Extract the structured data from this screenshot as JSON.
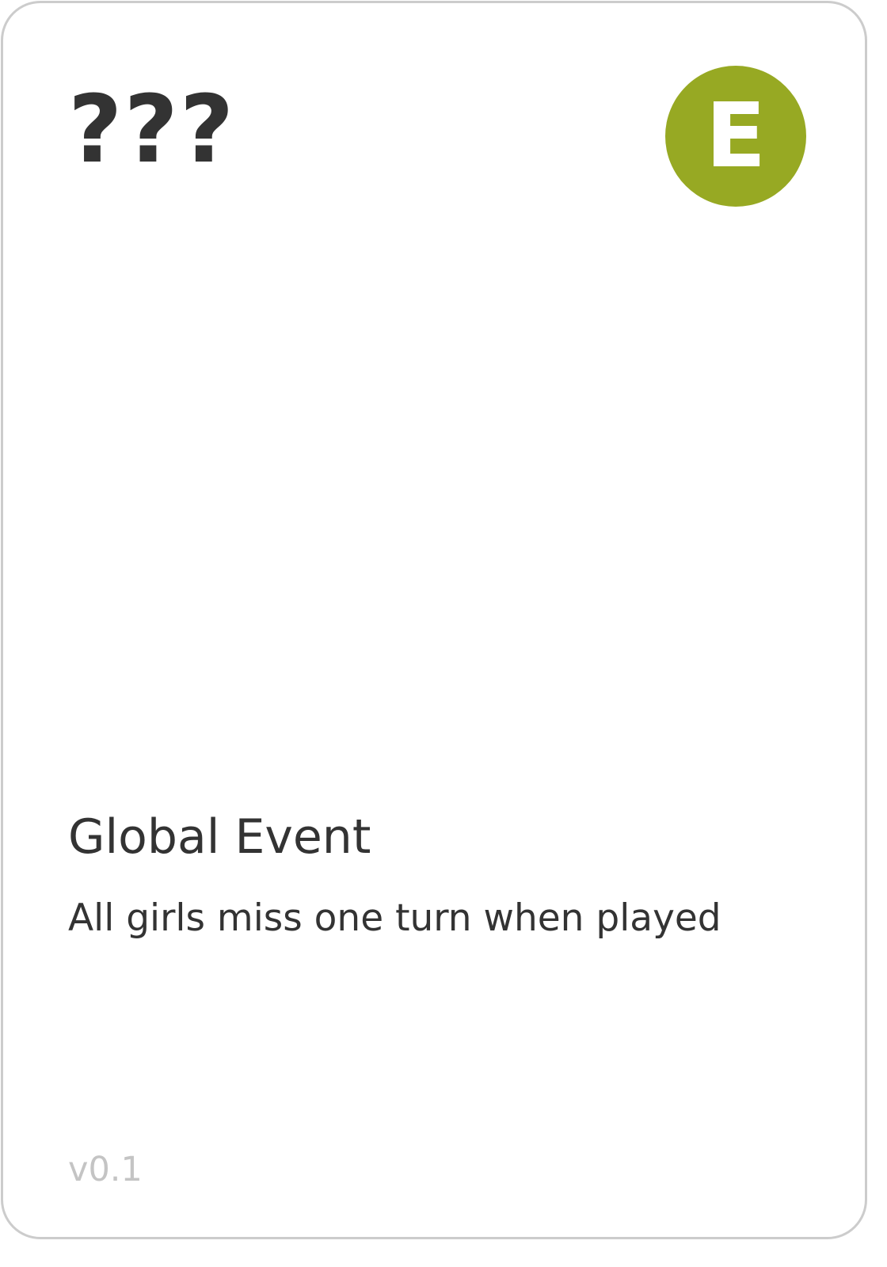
{
  "card": {
    "title": "???",
    "badge": {
      "letter": "E",
      "color": "#97a923"
    },
    "event_type": "Global Event",
    "description": "All girls miss one turn when played",
    "version": "v0.1",
    "colors": {
      "text": "#333333",
      "border": "#cccccc",
      "version_text": "#c4c4c4"
    }
  }
}
